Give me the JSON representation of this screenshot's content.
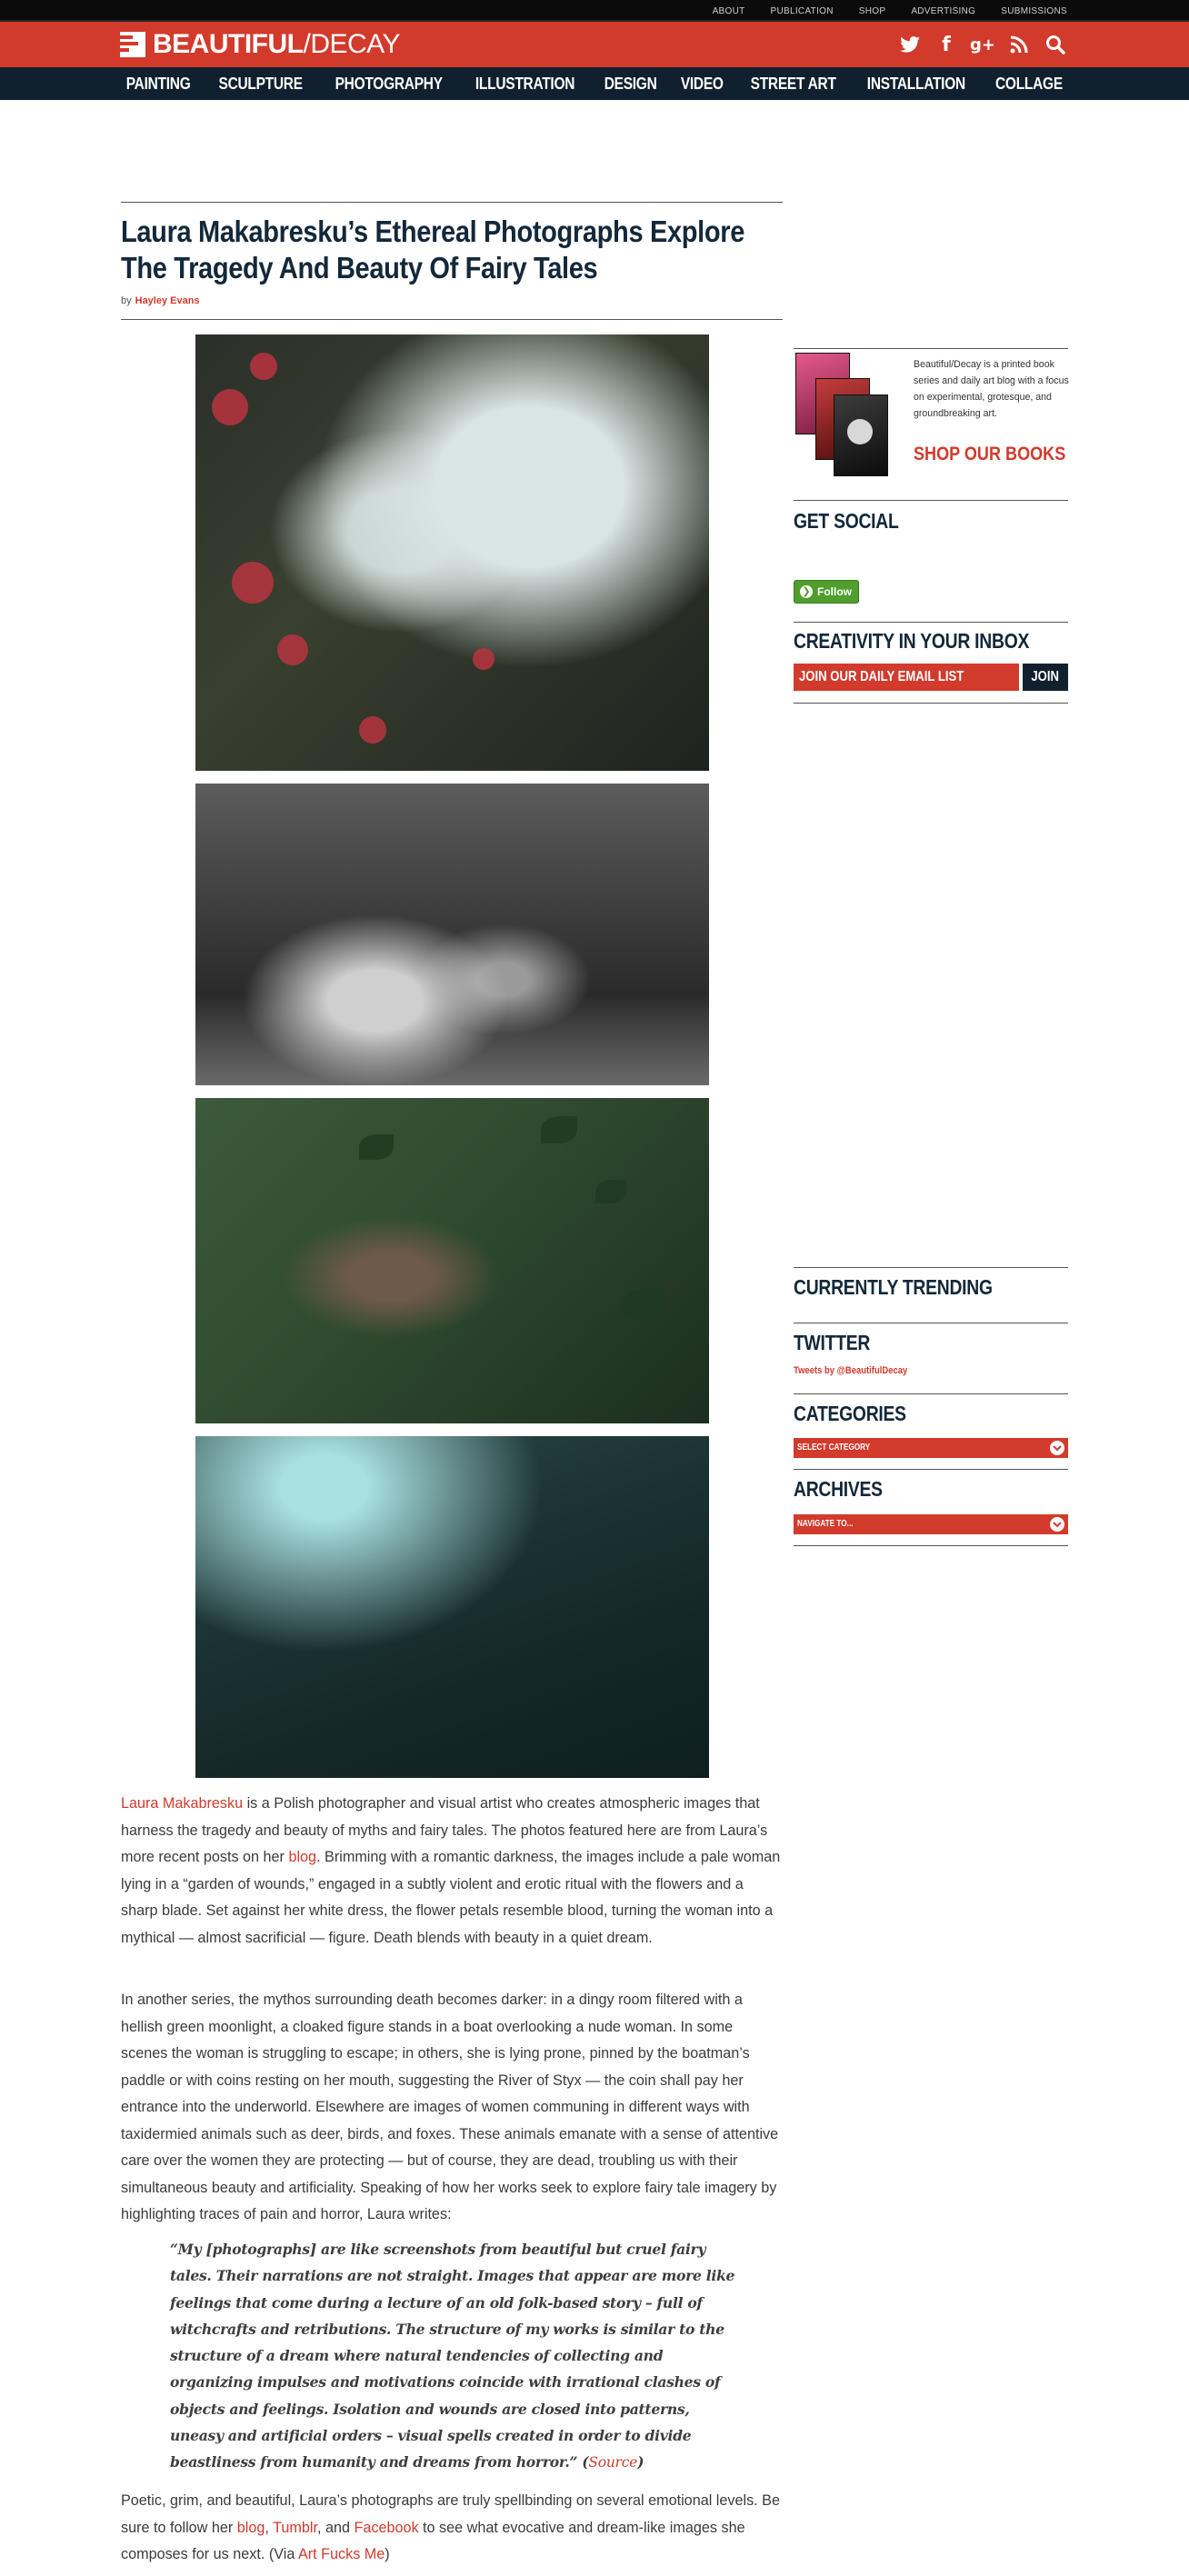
{
  "header": {
    "top_links": [
      "ABOUT",
      "PUBLICATION",
      "SHOP",
      "ADVERTISING",
      "SUBMISSIONS"
    ],
    "logo_bold": "BEAUTIFUL",
    "logo_light": "/DECAY",
    "social_icons": [
      "twitter-icon",
      "facebook-icon",
      "google-plus-icon",
      "rss-icon",
      "search-icon"
    ],
    "nav": [
      "PAINTING",
      "SCULPTURE",
      "PHOTOGRAPHY",
      "ILLUSTRATION",
      "DESIGN",
      "VIDEO",
      "STREET ART",
      "INSTALLATION",
      "COLLAGE"
    ],
    "brand_colors": {
      "red": "#d23a2c",
      "navy": "#10202e",
      "black": "#0b0b0b"
    }
  },
  "article": {
    "title": "Laura Makabresku’s Ethereal Photographs Explore The Tragedy And Beauty Of Fairy Tales",
    "by_label": "by",
    "author": "Hayley Evans",
    "para1": {
      "link_name": "Laura Makabresku",
      "t1": " is a Polish photographer and visual artist who creates atmospheric images that harness the tragedy and beauty of myths and fairy tales. The photos featured here are from Laura’s more recent posts on her ",
      "link_blog": "blog",
      "t2": ". Brimming with a romantic darkness, the images include a pale woman lying in a “garden of wounds,” engaged in a subtly violent and erotic ritual with the flowers and a sharp blade. Set against her white dress, the flower petals resemble blood, turning the woman into a mythical — almost sacrificial — figure. Death blends with beauty in a quiet dream."
    },
    "para2": "In another series, the mythos surrounding death becomes darker: in a dingy room filtered with a hellish green moonlight, a cloaked figure stands in a boat overlooking a nude woman. In some scenes the woman is struggling to escape; in others, she is lying prone, pinned by the boatman’s paddle or with coins resting on her mouth, suggesting the River of Styx — the coin shall pay her entrance into the underworld. Elsewhere are images of women communing in different ways with taxidermied animals such as deer, birds, and foxes. These animals emanate with a sense of attentive care over the women they are protecting — but of course, they are dead, troubling us with their simultaneous beauty and artificiality. Speaking of how her works seek to explore fairy tale imagery by highlighting traces of pain and horror, Laura writes:",
    "quote": {
      "text": "“My [photographs] are like screenshots from beautiful but cruel fairy tales. Their narrations are not straight. Images that appear are more like feelings that come during a lecture of an old folk-based story – full of witchcrafts and retributions. The structure of my works is similar to the structure of a dream where natural tendencies of collecting and organizing impulses and motivations coincide with irrational clashes of objects and feelings. Isolation and wounds are closed into patterns, uneasy and artificial orders – visual spells created in order to divide beastliness from humanity and dreams from horror.”",
      "open_paren": " (",
      "source_link": "Source",
      "close_paren": ")"
    },
    "para3": {
      "t1": "Poetic, grim, and beautiful, Laura’s photographs are truly spellbinding on several emotional levels. Be sure to follow her ",
      "link_blog": "blog",
      "sep1": ", ",
      "link_tumblr": "Tumblr",
      "sep2": ", and ",
      "link_facebook": "Facebook",
      "t2": " to see what evocative and dream-like images she composes for us next. (Via ",
      "link_via": "Art Fucks Me",
      "t3": ")"
    }
  },
  "sidebar": {
    "books_text": "Beautiful/Decay is a printed book series and daily art blog with a focus on experimental, grotesque, and groundbreaking art.",
    "shop_label": "SHOP OUR BOOKS",
    "get_social": "GET SOCIAL",
    "follow_label": "Follow",
    "inbox_heading": "CREATIVITY IN YOUR INBOX",
    "email_placeholder": "JOIN OUR DAILY EMAIL LIST",
    "join_label": "JOIN",
    "trending": "CURRENTLY TRENDING",
    "twitter": "TWITTER",
    "tweets_by": "Tweets by @BeautifulDecay",
    "categories": "CATEGORIES",
    "select_category": "SELECT CATEGORY",
    "archives": "ARCHIVES",
    "navigate_to": "NAVIGATE TO..."
  }
}
